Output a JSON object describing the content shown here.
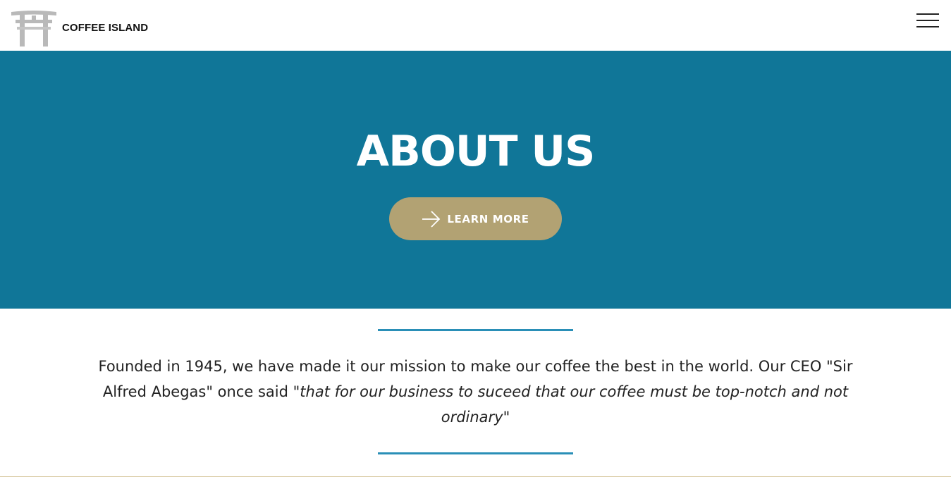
{
  "navbar": {
    "brand_name": "COFFEE ISLAND",
    "logo_icon": "torii-gate-icon",
    "menu_icon": "hamburger-menu-icon"
  },
  "hero": {
    "title": "ABOUT US",
    "button_label": "LEARN MORE",
    "button_icon": "arrow-right-icon",
    "background_color": "#107698",
    "button_color": "#b2a273"
  },
  "about": {
    "text_plain": "Founded in 1945, we have made it our mission to make our coffee the best in the world. Our CEO \"Sir Alfred Abegas\" once said ",
    "text_quote": "\"that for our business to suceed that our coffee must be top-notch and not ordinary\"",
    "divider_color": "#2a8fb7"
  }
}
